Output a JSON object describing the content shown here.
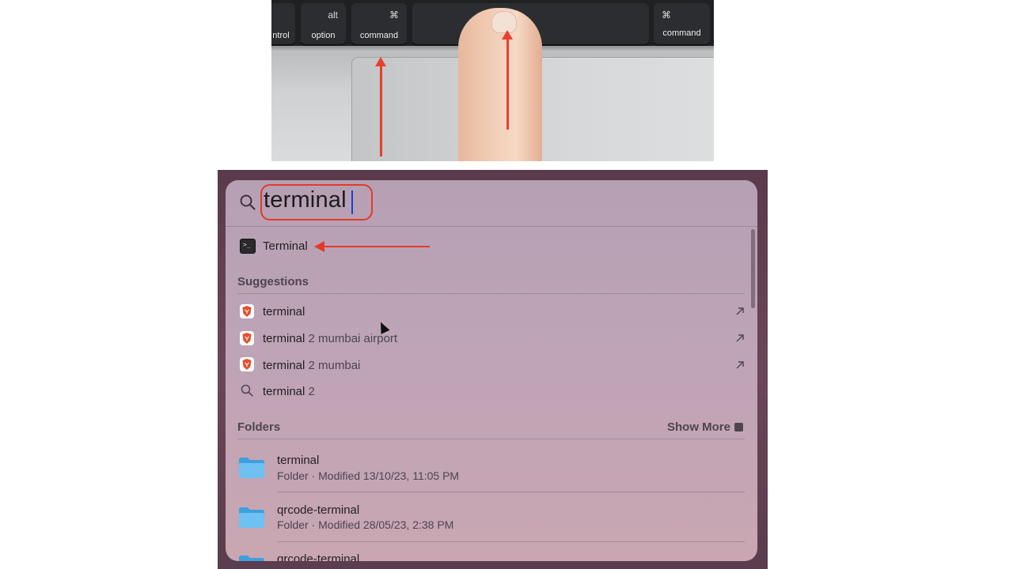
{
  "keyboard": {
    "keys": {
      "control": {
        "label": "ntrol"
      },
      "option": {
        "symbol": "alt",
        "label": "option"
      },
      "command_left": {
        "symbol": "⌘",
        "label": "command"
      },
      "command_right": {
        "symbol": "⌘",
        "label": "command"
      }
    }
  },
  "spotlight": {
    "query": "terminal",
    "top_hit": {
      "label": "Terminal",
      "icon": "terminal-app-icon"
    },
    "suggestions_header": "Suggestions",
    "suggestions": [
      {
        "bold": "terminal",
        "rest": "",
        "icon": "brave-icon",
        "has_open_arrow": true
      },
      {
        "bold": "terminal",
        "rest": " 2 mumbai airport",
        "icon": "brave-icon",
        "has_open_arrow": true
      },
      {
        "bold": "terminal",
        "rest": " 2 mumbai",
        "icon": "brave-icon",
        "has_open_arrow": true
      },
      {
        "bold": "terminal",
        "rest": " 2",
        "icon": "search-icon",
        "has_open_arrow": false
      }
    ],
    "folders_header": "Folders",
    "show_more": "Show More",
    "folders": [
      {
        "name": "terminal",
        "meta": "Folder · Modified 13/10/23, 11:05 PM"
      },
      {
        "name": "qrcode-terminal",
        "meta": "Folder · Modified 28/05/23, 2:38 PM"
      },
      {
        "name": "qrcode-terminal",
        "meta": ""
      }
    ]
  },
  "colors": {
    "annotation_red": "#e5392a",
    "caret_blue": "#1f3fd4",
    "folder_blue": "#5bb3ec"
  }
}
